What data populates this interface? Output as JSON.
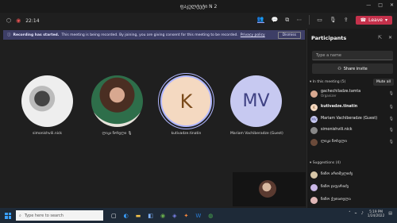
{
  "window": {
    "title": "ფაკულტეტი N 2",
    "min": "—",
    "max": "□",
    "close": "✕"
  },
  "toolbar": {
    "timer": "22:14",
    "leave_label": "Leave"
  },
  "banner": {
    "bold": "Recording has started.",
    "text": "This meeting is being recorded. By joining, you are giving consent for this meeting to be recorded.",
    "link": "Privacy policy",
    "dismiss": "Dismiss"
  },
  "tiles": [
    {
      "name": "simonishvili.nick",
      "initials": ""
    },
    {
      "name": "ლიკა ჩოხელი",
      "initials": ""
    },
    {
      "name": "kutivadze.tinatin",
      "initials": "K"
    },
    {
      "name": "Mariam Vachiberadze (Guest)",
      "initials": "MV"
    }
  ],
  "panel": {
    "title": "Participants",
    "search_placeholder": "Type a name",
    "share_label": "Share invite",
    "in_meeting": "In this meeting (5)",
    "mute_all": "Mute all",
    "suggestions": "Suggestions (4)",
    "participants": [
      {
        "name": "gachechiladze.tamta",
        "sub": "Organizer",
        "color": "#d8a890"
      },
      {
        "name": "kutivadze.tinatin",
        "sub": "",
        "color": "#f4d9c1"
      },
      {
        "name": "Mariam Vachiberadze (Guest)",
        "sub": "",
        "color": "#c7c9f1"
      },
      {
        "name": "simonishvili.nick",
        "sub": "",
        "color": "#888888"
      },
      {
        "name": "ლიკა ჩოხელი",
        "sub": "",
        "color": "#6a4a3a"
      }
    ],
    "suggested": [
      {
        "name": "ნინო ართმელიძე",
        "color": "#d7c6a8"
      },
      {
        "name": "ნინო ჯაფარიძე",
        "color": "#c9b7e6"
      },
      {
        "name": "ნინო ქუთათელა",
        "color": "#e0b7b7"
      }
    ]
  },
  "taskbar": {
    "search_placeholder": "Type here to search",
    "time": "5:19 PM",
    "date": "1/24/2022"
  }
}
